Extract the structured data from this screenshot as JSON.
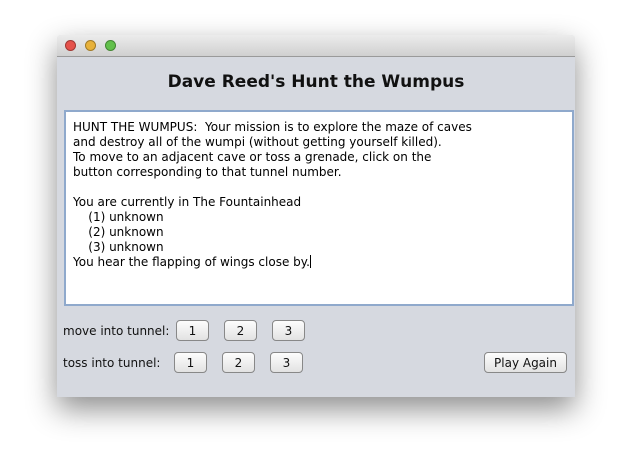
{
  "window": {
    "title_lights": [
      "close",
      "minimize",
      "zoom"
    ]
  },
  "heading": "Dave Reed's Hunt the Wumpus",
  "output_lines": [
    "HUNT THE WUMPUS:  Your mission is to explore the maze of caves",
    "and destroy all of the wumpi (without getting yourself killed).",
    "To move to an adjacent cave or toss a grenade, click on the",
    "button corresponding to that tunnel number.",
    "",
    "You are currently in The Fountainhead",
    "    (1) unknown",
    "    (2) unknown",
    "    (3) unknown",
    "You hear the flapping of wings close by."
  ],
  "move": {
    "label": "move into tunnel:",
    "buttons": [
      "1",
      "2",
      "3"
    ]
  },
  "toss": {
    "label": "toss into tunnel:",
    "buttons": [
      "1",
      "2",
      "3"
    ]
  },
  "play_again": "Play Again",
  "colors": {
    "close": "#e5514a",
    "minimize": "#e7b13a",
    "zoom": "#62c04b"
  }
}
